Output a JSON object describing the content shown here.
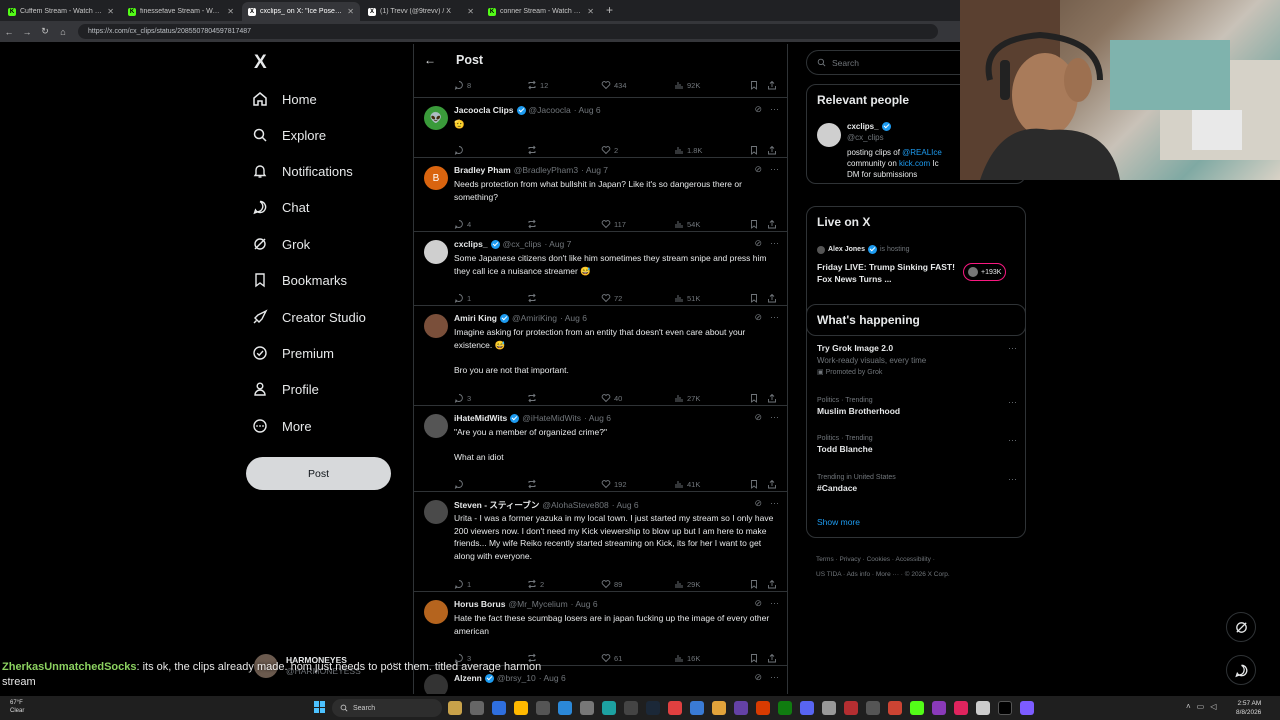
{
  "browser": {
    "tabs": [
      {
        "label": "Cuffem Stream - Watch Live o",
        "active": false,
        "fav_color": "#53fc18"
      },
      {
        "label": "finessefave Stream - Watch Li",
        "active": false,
        "fav_color": "#53fc18"
      },
      {
        "label": "cxclips_ on X: \"Ice Poseidon meet",
        "active": true,
        "fav_color": "#ffffff"
      },
      {
        "label": "(1) Trevv (@9trevv) / X",
        "active": false,
        "fav_color": "#ffffff"
      },
      {
        "label": "conner Stream - Watch Live on Ki",
        "active": false,
        "fav_color": "#53fc18"
      }
    ],
    "new_tab": "+",
    "url": "https://x.com/cx_clips/status/2085507804597817487"
  },
  "nav": {
    "logo": "X",
    "items": [
      {
        "label": "Home",
        "icon": "home-icon"
      },
      {
        "label": "Explore",
        "icon": "search-icon"
      },
      {
        "label": "Notifications",
        "icon": "bell-icon"
      },
      {
        "label": "Chat",
        "icon": "chat-icon"
      },
      {
        "label": "Grok",
        "icon": "grok-icon"
      },
      {
        "label": "Bookmarks",
        "icon": "bookmark-icon"
      },
      {
        "label": "Creator Studio",
        "icon": "rocket-icon"
      },
      {
        "label": "Premium",
        "icon": "verified-icon"
      },
      {
        "label": "Profile",
        "icon": "person-icon"
      },
      {
        "label": "More",
        "icon": "more-circle-icon"
      }
    ],
    "post_label": "Post",
    "account": {
      "name": "HARMONEYES",
      "handle": "@HARMONEYESS",
      "menu": "···"
    }
  },
  "timeline": {
    "header": {
      "back": "←",
      "title": "Post"
    },
    "top_actions": {
      "replies": "8",
      "reposts": "12",
      "likes": "434",
      "views": "92K"
    },
    "tweets": [
      {
        "name": "Jacoocla Clips",
        "verified": true,
        "handle": "@Jacoocla",
        "date": "· Aug 6",
        "text": "🫡",
        "replies": "",
        "reposts": "",
        "likes": "2",
        "views": "1.8K",
        "avatar_color": "#3a9a3a",
        "avatar_text": "👽"
      },
      {
        "name": "Bradley Pham",
        "verified": false,
        "handle": "@BradleyPham3",
        "date": "· Aug 7",
        "text": "Needs protection from what bullshit in Japan? Like it's so dangerous there or something?",
        "replies": "4",
        "reposts": "",
        "likes": "117",
        "views": "54K",
        "avatar_color": "#d9640f",
        "avatar_text": "B"
      },
      {
        "name": "cxclips_",
        "verified": true,
        "handle": "@cx_clips",
        "date": "· Aug 7",
        "text": "Some Japanese citizens don't like him sometimes they stream snipe and press him they call ice a nuisance streamer 😅",
        "replies": "1",
        "reposts": "",
        "likes": "72",
        "views": "51K",
        "avatar_color": "#cfcfcf",
        "avatar_text": ""
      },
      {
        "name": "Amiri King",
        "verified": true,
        "handle": "@AmiriKing",
        "date": "· Aug 6",
        "text": "Imagine asking for protection from an entity that doesn't even care about your existence. 😅\n\nBro you are not that important.",
        "replies": "3",
        "reposts": "",
        "likes": "40",
        "views": "27K",
        "avatar_color": "#7a4f3a",
        "avatar_text": ""
      },
      {
        "name": "iHateMidWits",
        "verified": true,
        "handle": "@iHateMidWits",
        "date": "· Aug 6",
        "text": "\"Are you a member of organized crime?\"\n\nWhat an idiot",
        "replies": "",
        "reposts": "",
        "likes": "192",
        "views": "41K",
        "avatar_color": "#555555",
        "avatar_text": ""
      },
      {
        "name": "Steven - スティーブン",
        "verified": false,
        "handle": "@AlohaSteve808",
        "date": "· Aug 6",
        "text": "Urita - I was a former yazuka in my local town.  I just started my stream so I only have 200 viewers now. I don't need my Kick viewership to blow up but I am here to make friends... My wife Reiko recently started streaming on Kick, its for her I want to get along with everyone.",
        "replies": "1",
        "reposts": "2",
        "likes": "89",
        "views": "29K",
        "avatar_color": "#4a4a4a",
        "avatar_text": ""
      },
      {
        "name": "Horus Borus",
        "verified": false,
        "handle": "@Mr_Mycelium",
        "date": "· Aug 6",
        "text": "Hate the fact these scumbag losers are in japan fucking up the image of every other american",
        "replies": "3",
        "reposts": "",
        "likes": "61",
        "views": "16K",
        "avatar_color": "#b5641e",
        "avatar_text": ""
      },
      {
        "name": "Alzenn",
        "verified": true,
        "handle": "@brsy_10",
        "date": "· Aug 6",
        "text": "",
        "replies": "",
        "reposts": "",
        "likes": "",
        "views": "",
        "avatar_color": "#333333",
        "avatar_text": ""
      }
    ]
  },
  "sidebar": {
    "search_placeholder": "Search",
    "relevant": {
      "title": "Relevant people",
      "name": "cxclips_",
      "handle": "@cx_clips",
      "bio_1": "posting clips of",
      "bio_link_1": "@REALIce",
      "bio_2": "community on",
      "bio_link_2": "kick.com",
      "bio_3": "Ic",
      "bio_4": "DM for submissions"
    },
    "live": {
      "title": "Live on X",
      "host": "Alex Jones",
      "host_suffix": "is hosting",
      "headline": "Friday LIVE: Trump Sinking FAST! Fox News Turns ...",
      "viewers": "+193K"
    },
    "happening": {
      "title": "What's happening",
      "promo": {
        "title": "Try Grok Image 2.0",
        "sub": "Work-ready visuals, every time",
        "promoted": "Promoted by Grok"
      },
      "trends": [
        {
          "cat": "Politics · Trending",
          "name": "Muslim Brotherhood"
        },
        {
          "cat": "Politics · Trending",
          "name": "Todd Blanche"
        },
        {
          "cat": "Trending in United States",
          "name": "#Candace"
        }
      ],
      "show_more": "Show more"
    },
    "footer": {
      "line1": [
        "Terms",
        "Privacy",
        "Cookies",
        "Accessibility"
      ],
      "line2": [
        "US TIDA",
        "Ads info",
        "More ···",
        "© 2026 X Corp."
      ]
    }
  },
  "chat_overlay": {
    "user": "ZherkasUnmatchedSocks",
    "message": ": its ok, the clips already made. hom just needs to post them. titled average harmon stream"
  },
  "taskbar": {
    "weather_temp": "67°F",
    "weather_desc": "Clear",
    "search": "Search",
    "time": "2:57 AM",
    "date": "8/8/2026"
  }
}
